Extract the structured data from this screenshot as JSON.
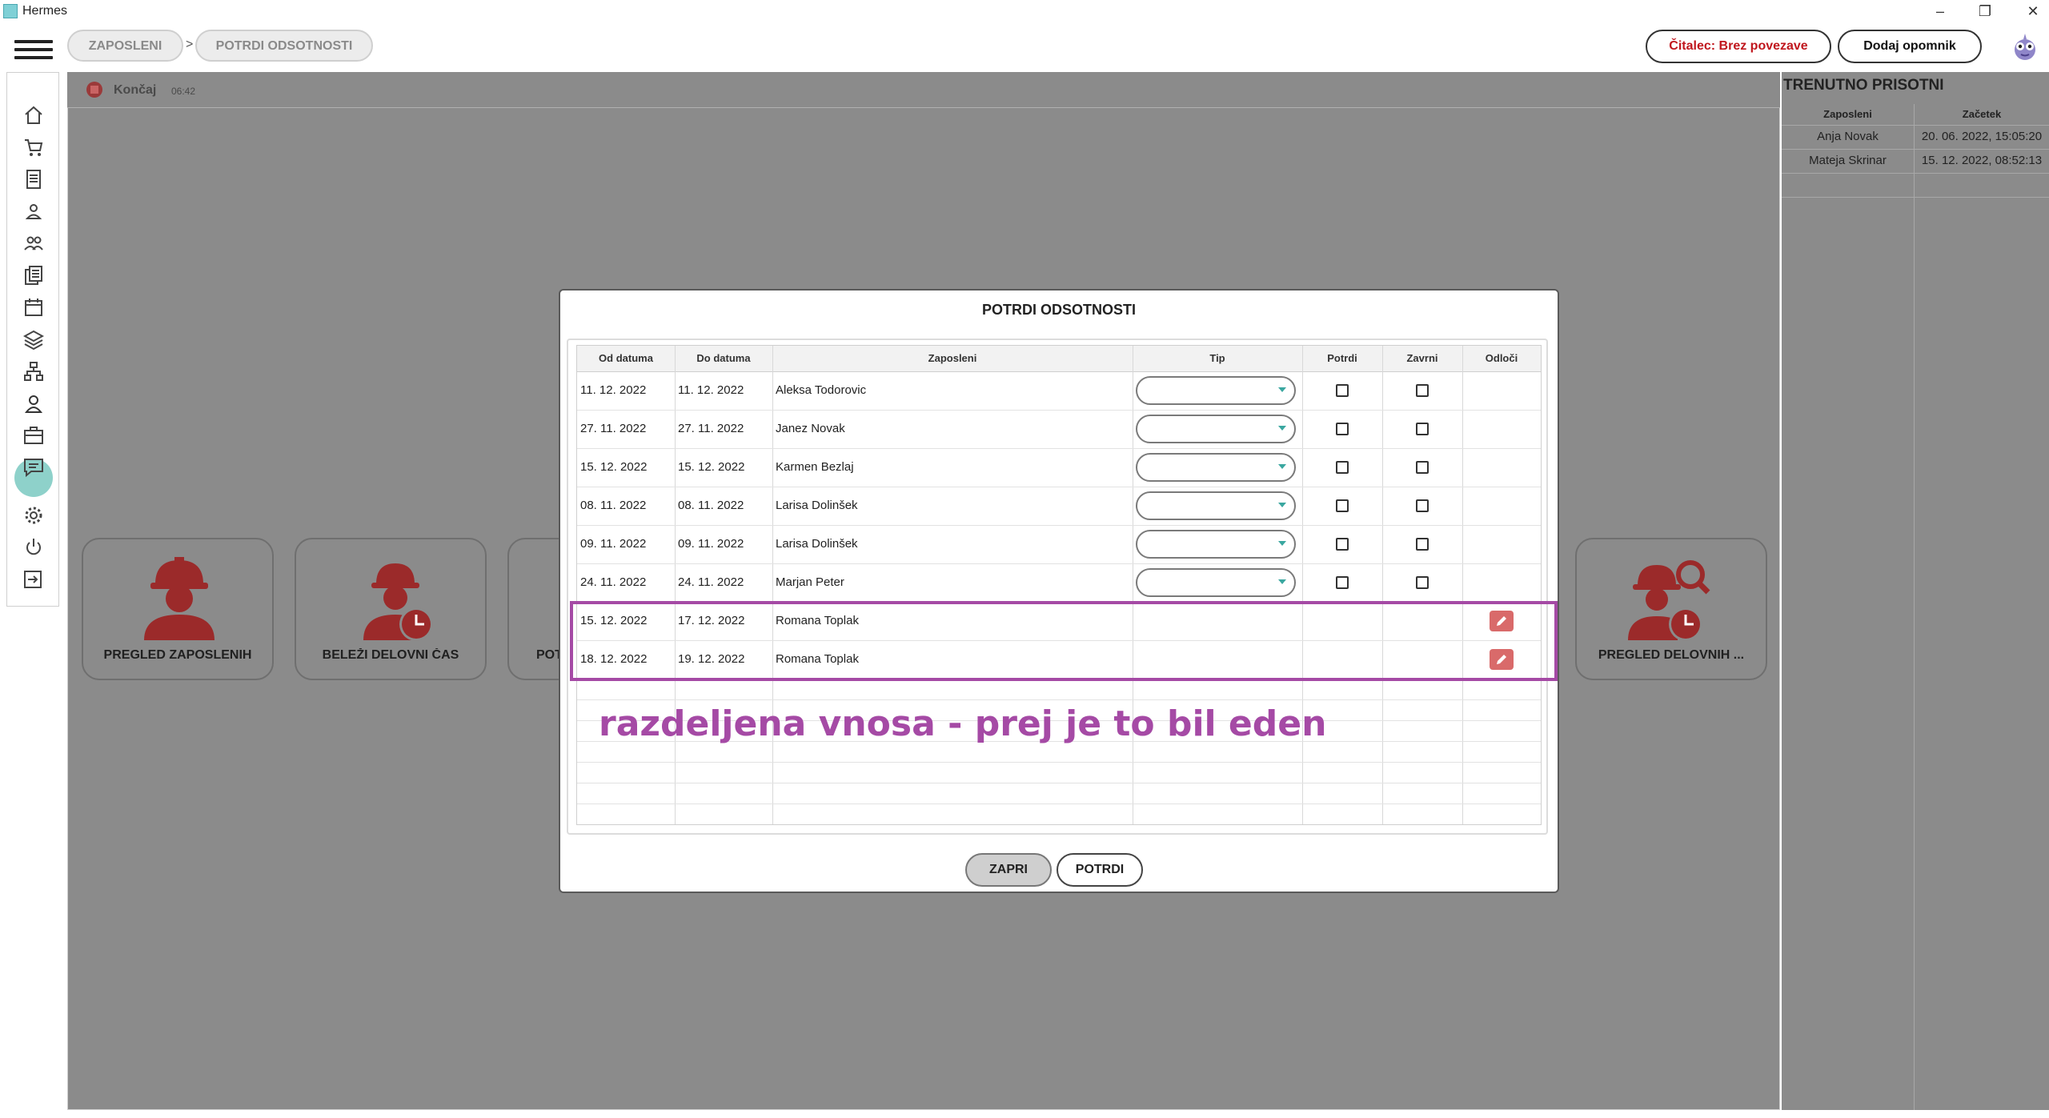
{
  "window": {
    "title": "Hermes",
    "minimize_glyph": "–",
    "restore_glyph": "❐",
    "close_glyph": "✕"
  },
  "breadcrumb": {
    "items": [
      "ZAPOSLENI",
      "POTRDI ODSOTNOSTI"
    ],
    "separator": ">"
  },
  "header": {
    "reader_status": "Čitalec: Brez povezave",
    "add_reminder": "Dodaj opomnik"
  },
  "sidebar": {
    "icons": [
      "home-icon",
      "cart-icon",
      "document-icon",
      "person-icon",
      "people-icon",
      "reports-icon",
      "calendar-icon",
      "layers-icon",
      "org-chart-icon",
      "employee-icon",
      "briefcase-icon",
      "chat-icon",
      "gear-icon",
      "power-icon",
      "logout-icon"
    ],
    "selected": "employee-icon"
  },
  "session": {
    "end_label": "Končaj",
    "elapsed": "06:42"
  },
  "tiles": [
    {
      "label": "PREGLED ZAPOSLENIH",
      "icon": "worker-icon"
    },
    {
      "label": "BELEŽI DELOVNI ČAS",
      "icon": "worker-clock-icon"
    },
    {
      "label": "POT",
      "icon": "partial-tile"
    },
    {
      "label": "PREGLED DELOVNIH ...",
      "icon": "worker-search-clock-icon"
    }
  ],
  "present_panel": {
    "title": "TRENUTNO PRISOTNI",
    "columns": [
      "Zaposleni",
      "Začetek"
    ],
    "rows": [
      {
        "employee": "Anja Novak",
        "start": "20. 06. 2022, 15:05:20"
      },
      {
        "employee": "Mateja Skrinar",
        "start": "15. 12. 2022, 08:52:13"
      }
    ]
  },
  "modal": {
    "title": "POTRDI ODSOTNOSTI",
    "columns": [
      "Od datuma",
      "Do datuma",
      "Zaposleni",
      "Tip",
      "Potrdi",
      "Zavrni",
      "Odloči"
    ],
    "rows": [
      {
        "from": "11. 12. 2022",
        "to": "11. 12. 2022",
        "employee": "Aleksa Todorovic",
        "tip": "",
        "editable": true
      },
      {
        "from": "27. 11. 2022",
        "to": "27. 11. 2022",
        "employee": "Janez Novak",
        "tip": "",
        "editable": true
      },
      {
        "from": "15. 12. 2022",
        "to": "15. 12. 2022",
        "employee": "Karmen Bezlaj",
        "tip": "",
        "editable": true
      },
      {
        "from": "08. 11. 2022",
        "to": "08. 11. 2022",
        "employee": "Larisa Dolinšek",
        "tip": "",
        "editable": true
      },
      {
        "from": "09. 11. 2022",
        "to": "09. 11. 2022",
        "employee": "Larisa Dolinšek",
        "tip": "",
        "editable": true
      },
      {
        "from": "24. 11. 2022",
        "to": "24. 11. 2022",
        "employee": "Marjan Peter",
        "tip": "",
        "editable": true
      },
      {
        "from": "15. 12. 2022",
        "to": "17. 12. 2022",
        "employee": "Romana Toplak",
        "tip": "",
        "editable": false
      },
      {
        "from": "18. 12. 2022",
        "to": "19. 12. 2022",
        "employee": "Romana Toplak",
        "tip": "",
        "editable": false
      }
    ],
    "annotation": "razdeljena vnosa - prej je to bil eden",
    "buttons": {
      "close": "ZAPRI",
      "confirm": "POTRDI"
    }
  },
  "colors": {
    "accent_red": "#b22a2a",
    "annotation_purple": "#a54aa5",
    "teal": "#8ed1ca",
    "overlay_gray": "#8b8b8b"
  }
}
